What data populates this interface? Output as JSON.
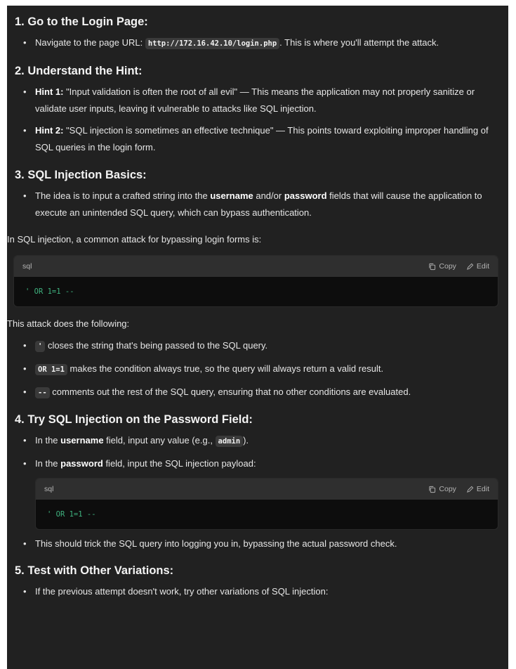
{
  "s1": {
    "title": "1. Go to the Login Page:",
    "b1_pre": "Navigate to the page URL: ",
    "b1_code": "http://172.16.42.10/login.php",
    "b1_post": ". This is where you'll attempt the attack."
  },
  "s2": {
    "title": "2. Understand the Hint:",
    "h1_label": "Hint 1:",
    "h1_text": " \"Input validation is often the root of all evil\" — This means the application may not properly sanitize or validate user inputs, leaving it vulnerable to attacks like SQL injection.",
    "h2_label": "Hint 2:",
    "h2_text": " \"SQL injection is sometimes an effective technique\" — This points toward exploiting improper handling of SQL queries in the login form."
  },
  "s3": {
    "title": "3. SQL Injection Basics:",
    "b1_pre": "The idea is to input a crafted string into the ",
    "b1_username": "username",
    "b1_mid": " and/or ",
    "b1_password": "password",
    "b1_post": " fields that will cause the application to execute an unintended SQL query, which can bypass authentication."
  },
  "intro_para": "In SQL injection, a common attack for bypassing login forms is:",
  "code1": {
    "lang": "sql",
    "copy": "Copy",
    "edit": "Edit",
    "code": "' OR 1=1 --"
  },
  "attack_para": "This attack does the following:",
  "attack_items": [
    {
      "code": "'",
      "text": " closes the string that's being passed to the SQL query."
    },
    {
      "code": "OR 1=1",
      "text": " makes the condition always true, so the query will always return a valid result."
    },
    {
      "code": "--",
      "text": " comments out the rest of the SQL query, ensuring that no other conditions are evaluated."
    }
  ],
  "s4": {
    "title": "4. Try SQL Injection on the Password Field:",
    "b1_pre": "In the ",
    "b1_bold": "username",
    "b1_mid": " field, input any value (e.g., ",
    "b1_code": "admin",
    "b1_post": ").",
    "b2_pre": "In the ",
    "b2_bold": "password",
    "b2_post": " field, input the SQL injection payload:",
    "b3": "This should trick the SQL query into logging you in, bypassing the actual password check."
  },
  "code2": {
    "lang": "sql",
    "copy": "Copy",
    "edit": "Edit",
    "code": "' OR 1=1 --"
  },
  "s5": {
    "title": "5. Test with Other Variations:",
    "b1": "If the previous attempt doesn't work, try other variations of SQL injection:"
  }
}
